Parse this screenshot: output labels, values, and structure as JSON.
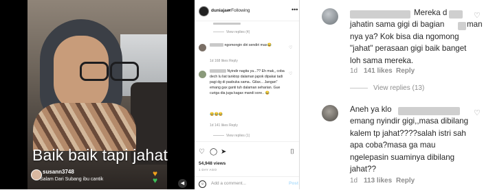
{
  "video": {
    "caption": "Baik baik tapi jahat",
    "live_comment": {
      "username": "susann3748",
      "text": "Salam Dari Subang ibu cantik"
    }
  },
  "ig_post": {
    "username": "duniajaer",
    "following_label": "• Following",
    "more_icon": "more-dots-icon",
    "view_replies_1": "View replies (4)",
    "comment1": {
      "text": "ngomongin diri sendiri max😂",
      "meta": "1d   168 likes   Reply"
    },
    "comment2": {
      "text": "Nyindir nagita ya...?? Eh mak,, coba dech lu liat tanktop dalaman japok dipakai tadi pagi dg di pasbuka sama.. Gilax... Jangan\" emang gax ganti tuh dalaman seharian. Gue curiga dia juga kagax mandi sore.. 😂",
      "emoji_row": "😂😂😂",
      "meta": "1d   141 likes   Reply"
    },
    "view_replies_2": "View replies (1)",
    "likes": "54,948 views",
    "time_ago": "1 DAY AGO",
    "add_comment_placeholder": "Add a comment...",
    "post_button": "Post"
  },
  "zoom_comments": [
    {
      "text_first": "Mereka d",
      "text_mid": "man",
      "text_rest": "jahatin sama gigi di bagian",
      "text_line3": "nya ya? Kok bisa dia ngomong",
      "text_line4": "\"jahat\" perasaan gigi baik banget",
      "text_line5": "loh sama mereka.",
      "day": "1d",
      "likes": "141 likes",
      "reply": "Reply",
      "view_replies": "View replies (13)"
    },
    {
      "line1": "Aneh ya klo",
      "line2": "emang nyindir gigi,,masa dibilang",
      "line3": "kalem tp jahat????salah istri sah",
      "line4": "apa coba?masa ga mau",
      "line5": "ngelepasin suaminya dibilang",
      "line6": "jahat??",
      "day": "1d",
      "likes": "113 likes",
      "reply": "Reply"
    }
  ]
}
